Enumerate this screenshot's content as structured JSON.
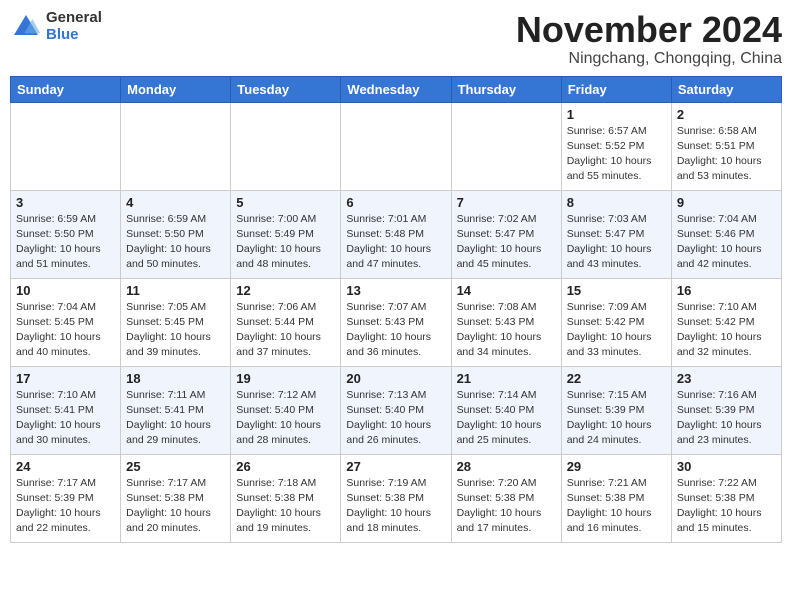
{
  "logo": {
    "general": "General",
    "blue": "Blue"
  },
  "title": "November 2024",
  "location": "Ningchang, Chongqing, China",
  "days_of_week": [
    "Sunday",
    "Monday",
    "Tuesday",
    "Wednesday",
    "Thursday",
    "Friday",
    "Saturday"
  ],
  "weeks": [
    [
      {
        "day": "",
        "info": ""
      },
      {
        "day": "",
        "info": ""
      },
      {
        "day": "",
        "info": ""
      },
      {
        "day": "",
        "info": ""
      },
      {
        "day": "",
        "info": ""
      },
      {
        "day": "1",
        "info": "Sunrise: 6:57 AM\nSunset: 5:52 PM\nDaylight: 10 hours\nand 55 minutes."
      },
      {
        "day": "2",
        "info": "Sunrise: 6:58 AM\nSunset: 5:51 PM\nDaylight: 10 hours\nand 53 minutes."
      }
    ],
    [
      {
        "day": "3",
        "info": "Sunrise: 6:59 AM\nSunset: 5:50 PM\nDaylight: 10 hours\nand 51 minutes."
      },
      {
        "day": "4",
        "info": "Sunrise: 6:59 AM\nSunset: 5:50 PM\nDaylight: 10 hours\nand 50 minutes."
      },
      {
        "day": "5",
        "info": "Sunrise: 7:00 AM\nSunset: 5:49 PM\nDaylight: 10 hours\nand 48 minutes."
      },
      {
        "day": "6",
        "info": "Sunrise: 7:01 AM\nSunset: 5:48 PM\nDaylight: 10 hours\nand 47 minutes."
      },
      {
        "day": "7",
        "info": "Sunrise: 7:02 AM\nSunset: 5:47 PM\nDaylight: 10 hours\nand 45 minutes."
      },
      {
        "day": "8",
        "info": "Sunrise: 7:03 AM\nSunset: 5:47 PM\nDaylight: 10 hours\nand 43 minutes."
      },
      {
        "day": "9",
        "info": "Sunrise: 7:04 AM\nSunset: 5:46 PM\nDaylight: 10 hours\nand 42 minutes."
      }
    ],
    [
      {
        "day": "10",
        "info": "Sunrise: 7:04 AM\nSunset: 5:45 PM\nDaylight: 10 hours\nand 40 minutes."
      },
      {
        "day": "11",
        "info": "Sunrise: 7:05 AM\nSunset: 5:45 PM\nDaylight: 10 hours\nand 39 minutes."
      },
      {
        "day": "12",
        "info": "Sunrise: 7:06 AM\nSunset: 5:44 PM\nDaylight: 10 hours\nand 37 minutes."
      },
      {
        "day": "13",
        "info": "Sunrise: 7:07 AM\nSunset: 5:43 PM\nDaylight: 10 hours\nand 36 minutes."
      },
      {
        "day": "14",
        "info": "Sunrise: 7:08 AM\nSunset: 5:43 PM\nDaylight: 10 hours\nand 34 minutes."
      },
      {
        "day": "15",
        "info": "Sunrise: 7:09 AM\nSunset: 5:42 PM\nDaylight: 10 hours\nand 33 minutes."
      },
      {
        "day": "16",
        "info": "Sunrise: 7:10 AM\nSunset: 5:42 PM\nDaylight: 10 hours\nand 32 minutes."
      }
    ],
    [
      {
        "day": "17",
        "info": "Sunrise: 7:10 AM\nSunset: 5:41 PM\nDaylight: 10 hours\nand 30 minutes."
      },
      {
        "day": "18",
        "info": "Sunrise: 7:11 AM\nSunset: 5:41 PM\nDaylight: 10 hours\nand 29 minutes."
      },
      {
        "day": "19",
        "info": "Sunrise: 7:12 AM\nSunset: 5:40 PM\nDaylight: 10 hours\nand 28 minutes."
      },
      {
        "day": "20",
        "info": "Sunrise: 7:13 AM\nSunset: 5:40 PM\nDaylight: 10 hours\nand 26 minutes."
      },
      {
        "day": "21",
        "info": "Sunrise: 7:14 AM\nSunset: 5:40 PM\nDaylight: 10 hours\nand 25 minutes."
      },
      {
        "day": "22",
        "info": "Sunrise: 7:15 AM\nSunset: 5:39 PM\nDaylight: 10 hours\nand 24 minutes."
      },
      {
        "day": "23",
        "info": "Sunrise: 7:16 AM\nSunset: 5:39 PM\nDaylight: 10 hours\nand 23 minutes."
      }
    ],
    [
      {
        "day": "24",
        "info": "Sunrise: 7:17 AM\nSunset: 5:39 PM\nDaylight: 10 hours\nand 22 minutes."
      },
      {
        "day": "25",
        "info": "Sunrise: 7:17 AM\nSunset: 5:38 PM\nDaylight: 10 hours\nand 20 minutes."
      },
      {
        "day": "26",
        "info": "Sunrise: 7:18 AM\nSunset: 5:38 PM\nDaylight: 10 hours\nand 19 minutes."
      },
      {
        "day": "27",
        "info": "Sunrise: 7:19 AM\nSunset: 5:38 PM\nDaylight: 10 hours\nand 18 minutes."
      },
      {
        "day": "28",
        "info": "Sunrise: 7:20 AM\nSunset: 5:38 PM\nDaylight: 10 hours\nand 17 minutes."
      },
      {
        "day": "29",
        "info": "Sunrise: 7:21 AM\nSunset: 5:38 PM\nDaylight: 10 hours\nand 16 minutes."
      },
      {
        "day": "30",
        "info": "Sunrise: 7:22 AM\nSunset: 5:38 PM\nDaylight: 10 hours\nand 15 minutes."
      }
    ]
  ]
}
